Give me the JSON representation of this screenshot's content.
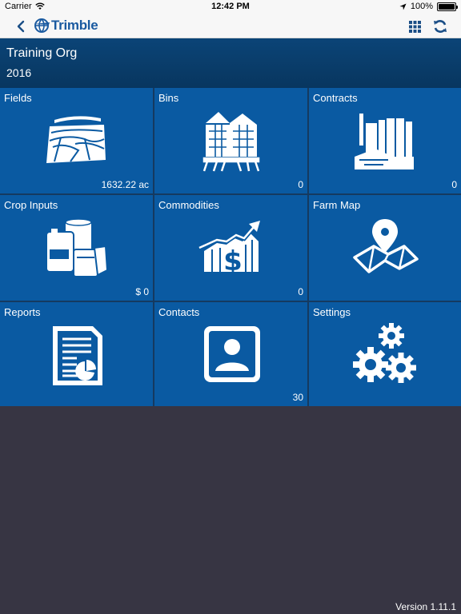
{
  "status_bar": {
    "carrier": "Carrier",
    "time": "12:42 PM",
    "battery": "100%"
  },
  "nav": {
    "logo_text": "Trimble"
  },
  "header": {
    "org_name": "Training Org",
    "year": "2016"
  },
  "tiles": [
    {
      "label": "Fields",
      "value": "1632.22 ac",
      "icon": "fields-icon"
    },
    {
      "label": "Bins",
      "value": "0",
      "icon": "grain-bin-icon"
    },
    {
      "label": "Contracts",
      "value": "0",
      "icon": "grain-elevator-icon"
    },
    {
      "label": "Crop Inputs",
      "value": "$ 0",
      "icon": "crop-inputs-icon"
    },
    {
      "label": "Commodities",
      "value": "0",
      "icon": "commodities-chart-icon"
    },
    {
      "label": "Farm Map",
      "value": "",
      "icon": "map-pin-icon"
    },
    {
      "label": "Reports",
      "value": "",
      "icon": "report-document-icon"
    },
    {
      "label": "Contacts",
      "value": "30",
      "icon": "contact-card-icon"
    },
    {
      "label": "Settings",
      "value": "",
      "icon": "gears-icon"
    }
  ],
  "footer": {
    "version": "Version 1.11.1"
  },
  "colors": {
    "tile": "#0a5aa2",
    "header": "#0b4477",
    "background": "#373543",
    "brand": "#1a5aa0"
  }
}
